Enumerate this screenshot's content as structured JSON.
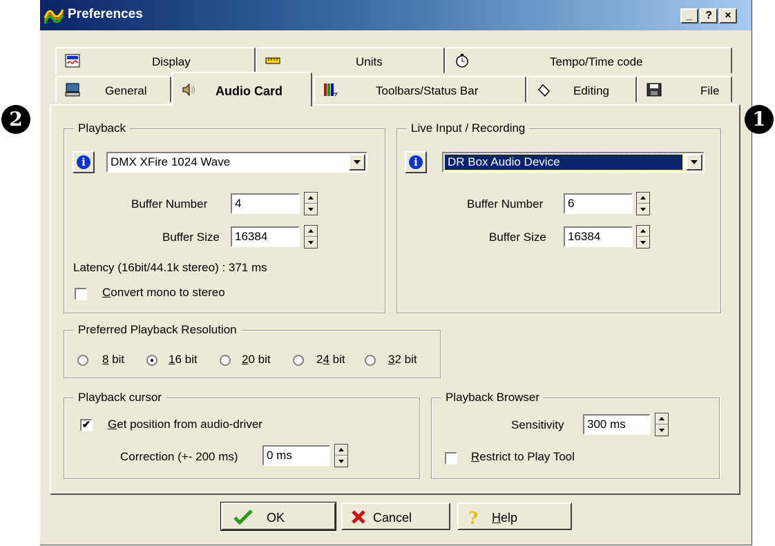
{
  "window": {
    "title": "Preferences",
    "controls": [
      "_",
      "?",
      "×"
    ]
  },
  "markers": {
    "left": "2",
    "right": "1"
  },
  "tabs_row1": [
    {
      "label": "Display",
      "icon": "display-icon"
    },
    {
      "label": "Units",
      "icon": "ruler-icon"
    },
    {
      "label": "Tempo/Time code",
      "icon": "clock-icon"
    }
  ],
  "tabs_row2": [
    {
      "label": "General",
      "icon": "computer-icon"
    },
    {
      "label": "Audio Card",
      "icon": "speaker-icon",
      "active": true
    },
    {
      "label": "Toolbars/Status Bar",
      "icon": "toolbar-icon"
    },
    {
      "label": "Editing",
      "icon": "hand-icon"
    },
    {
      "label": "File",
      "icon": "floppy-icon"
    }
  ],
  "playback": {
    "legend": "Playback",
    "device": "DMX XFire 1024 Wave",
    "buffer_number_label": "Buffer Number",
    "buffer_number": "4",
    "buffer_size_label": "Buffer Size",
    "buffer_size": "16384",
    "latency": "Latency (16bit/44.1k stereo) : 371 ms",
    "convert_mono_prefix": "C",
    "convert_mono_rest": "onvert mono to stereo",
    "convert_mono_checked": false
  },
  "live_input": {
    "legend": "Live Input / Recording",
    "device": "DR Box Audio Device",
    "buffer_number_label": "Buffer Number",
    "buffer_number": "6",
    "buffer_size_label": "Buffer Size",
    "buffer_size": "16384"
  },
  "resolution": {
    "legend": "Preferred Playback Resolution",
    "options": [
      {
        "key": "8",
        "rest": " bit",
        "selected": false
      },
      {
        "key": "1",
        "rest": "6 bit",
        "selected": true
      },
      {
        "key": "2",
        "rest": "0 bit",
        "selected": false
      },
      {
        "key": "2",
        "rest": "4 bit",
        "pre": "",
        "selected": false
      },
      {
        "key": "3",
        "rest": "2 bit",
        "selected": false
      }
    ]
  },
  "cursor": {
    "legend": "Playback cursor",
    "get_position_prefix": "G",
    "get_position_rest": "et position from audio-driver",
    "get_position_checked": true,
    "check_mark": "✔",
    "correction_label": "Correction (+- 200 ms)",
    "correction": "0 ms"
  },
  "browser": {
    "legend": "Playback Browser",
    "sensitivity_label": "Sensitivity",
    "sensitivity": "300 ms",
    "restrict_prefix": "R",
    "restrict_rest": "estrict to Play Tool",
    "restrict_checked": false
  },
  "buttons": {
    "ok": "OK",
    "cancel": "Cancel",
    "help_prefix": "H",
    "help_rest": "elp"
  },
  "colors": {
    "title_start": "#0a246a",
    "title_end": "#a6caf0",
    "selection": "#0a246a",
    "face": "#ece9d8"
  }
}
